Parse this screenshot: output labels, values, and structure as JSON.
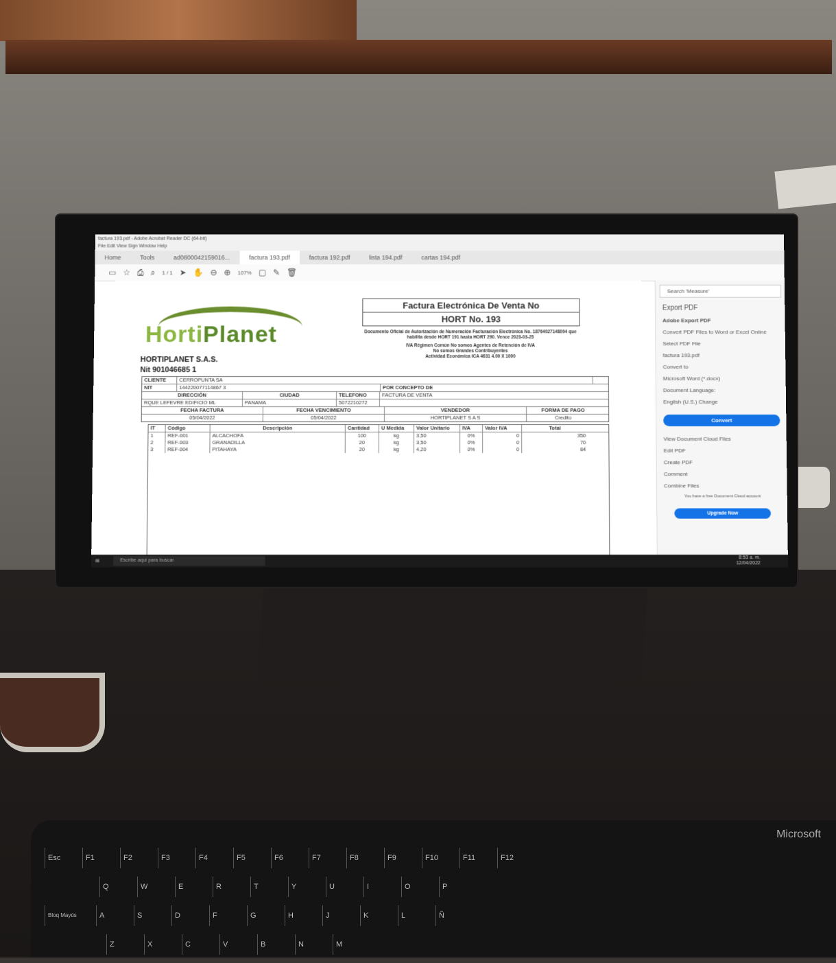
{
  "window": {
    "title": "factura 193.pdf - Adobe Acrobat Reader DC (64-bit)"
  },
  "menu": {
    "items": [
      "File",
      "Edit",
      "View",
      "Sign",
      "Window",
      "Help"
    ]
  },
  "tabs": [
    "Home",
    "Tools",
    "ad0800042159016...",
    "factura 193.pdf",
    "factura 192.pdf",
    "lista 194.pdf",
    "cartas 194.pdf"
  ],
  "toolbar": {
    "page": "1 / 1",
    "zoom": "107%"
  },
  "invoice": {
    "header_title": "Factura Electrónica De Venta No",
    "number": "HORT   No. 193",
    "legal_1": "Documento Oficial de Autorización de Numeración Facturación Electrónica No. 18764027148004 que habilita desde HORT 191 hasta HORT 290. Vence 2023-03-25",
    "legal_2": "IVA Régimen Común No somos Agentes de Retención de IVA",
    "legal_3": "No somos Grandes Contribuyentes",
    "legal_4": "Actividad Económica ICA 4631 4.00 X 1000",
    "logo_a": "Horti",
    "logo_b": "Planet",
    "company": "HORTIPLANET S.A.S.",
    "nit": "Nit   901046685 1",
    "client_label": "CLIENTE",
    "client": "CERROPUNTA SA",
    "nit_label": "NIT",
    "client_nit": "144220077114867 3",
    "address_label": "DIRECCIÓN",
    "city_label": "CIUDAD",
    "phone_label": "TELEFONO",
    "concept_label": "POR CONCEPTO DE",
    "address": "RQUE LEFEVRE EDIFICIO ML",
    "city": "PANAMA",
    "phone": "5072210272",
    "concept": "FACTURA DE VENTA",
    "date_label": "FECHA FACTURA",
    "due_label": "FECHA VENCIMIENTO",
    "seller_label": "VENDEDOR",
    "payment_label": "FORMA DE PAGO",
    "date": "05/04/2022",
    "due": "05/04/2022",
    "seller": "HORTIPLANET S A S",
    "payment": "Credito"
  },
  "table": {
    "headers": [
      "IT",
      "Código",
      "Descripción",
      "Cantidad",
      "U Medida",
      "Valor Unitario",
      "IVA",
      "Valor IVA",
      "Total"
    ],
    "rows": [
      [
        "1",
        "REF-001",
        "ALCACHOFA",
        "100",
        "kg",
        "3,50",
        "0%",
        "0",
        "350"
      ],
      [
        "2",
        "REF-003",
        "GRANADILLA",
        "20",
        "kg",
        "3,50",
        "0%",
        "0",
        "70"
      ],
      [
        "3",
        "REF-004",
        "PITAHAYA",
        "20",
        "kg",
        "4,20",
        "0%",
        "0",
        "84"
      ]
    ]
  },
  "sidebar": {
    "search_placeholder": "Search 'Measure'",
    "export_pdf": "Export PDF",
    "adobe_export": "Adobe Export PDF",
    "convert_desc": "Convert PDF Files to Word or Excel Online",
    "select_file": "Select PDF File",
    "file": "factura 193.pdf",
    "convert_to": "Convert to",
    "format": "Microsoft Word (*.docx)",
    "doc_lang": "Document Language:",
    "lang": "English (U.S.) Change",
    "convert_btn": "Convert",
    "view_cloud": "View Document Cloud Files",
    "edit_pdf": "Edit PDF",
    "create_pdf": "Create PDF",
    "comment": "Comment",
    "combine": "Combine Files",
    "free_acct": "You have a free Document Cloud account",
    "upgrade": "Upgrade Now"
  },
  "taskbar": {
    "search": "Escribe aquí para buscar",
    "time": "8:53 a. m.",
    "date": "12/04/2022"
  },
  "keyboard": {
    "brand": "Microsoft",
    "row1": [
      "Esc",
      "F1",
      "F2",
      "F3",
      "F4",
      "F5",
      "F6",
      "F7",
      "F8",
      "F9",
      "F10",
      "F11",
      "F12"
    ],
    "row2": [
      "Q",
      "W",
      "E",
      "R",
      "T",
      "Y",
      "U",
      "I",
      "O",
      "P"
    ],
    "row3": [
      "Bloq Mayús",
      "A",
      "S",
      "D",
      "F",
      "G",
      "H",
      "J",
      "K",
      "L",
      "Ñ"
    ],
    "row4": [
      "Z",
      "X",
      "C",
      "V",
      "B",
      "N",
      "M"
    ]
  }
}
